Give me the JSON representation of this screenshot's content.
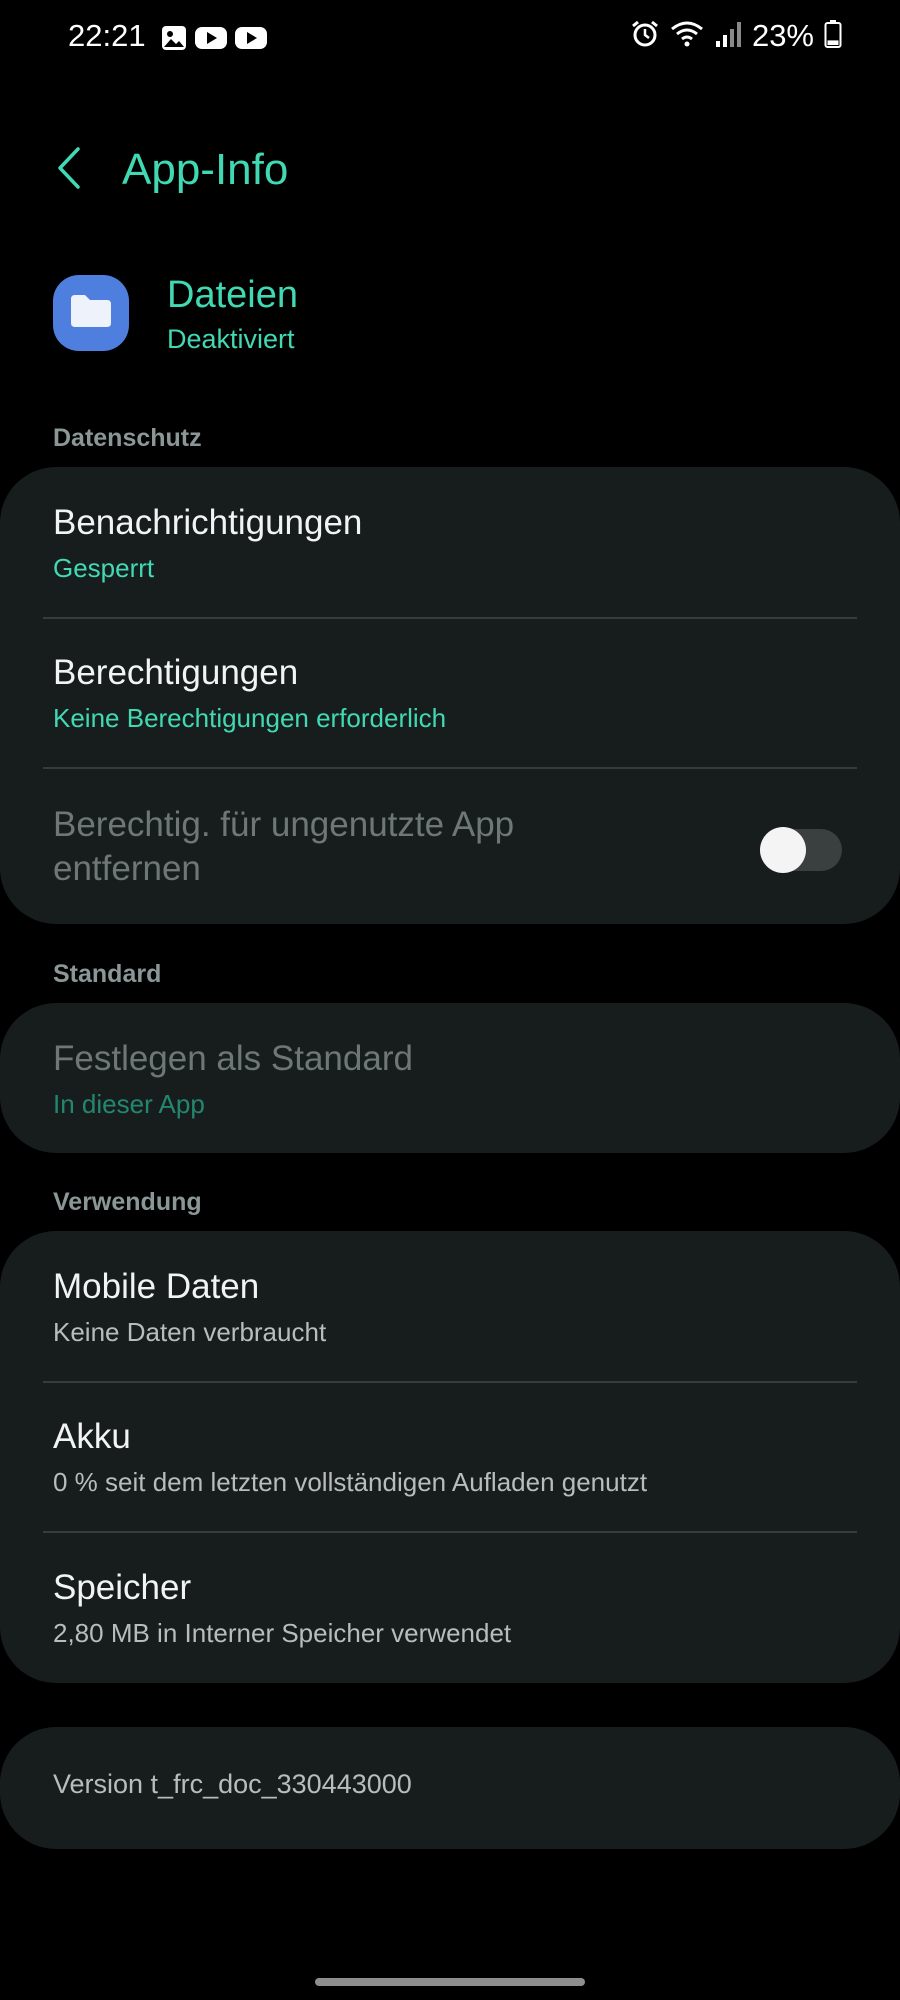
{
  "status_bar": {
    "time": "22:21",
    "battery_percent": "23%",
    "left_icons": [
      "gallery-icon",
      "youtube-icon",
      "youtube-icon"
    ],
    "right_icons": [
      "alarm-icon",
      "wifi-icon",
      "signal-icon",
      "battery-icon"
    ],
    "battery_level": 0.23
  },
  "header": {
    "title": "App-Info"
  },
  "app": {
    "name": "Dateien",
    "status": "Deaktiviert",
    "icon": "folder-icon",
    "icon_color": "#4f7fde"
  },
  "sections": {
    "privacy": {
      "label": "Datenschutz",
      "notifications": {
        "title": "Benachrichtigungen",
        "value": "Gesperrt"
      },
      "permissions": {
        "title": "Berechtigungen",
        "value": "Keine Berechtigungen erforderlich"
      },
      "unused_app": {
        "title_line1": "Berechtig. für ungenutzte App",
        "title_line2": "entfernen",
        "enabled": false
      }
    },
    "default": {
      "label": "Standard",
      "set_default": {
        "title": "Festlegen als Standard",
        "value": "In dieser App"
      }
    },
    "usage": {
      "label": "Verwendung",
      "mobile_data": {
        "title": "Mobile Daten",
        "value": "Keine Daten verbraucht"
      },
      "battery": {
        "title": "Akku",
        "value": "0 % seit dem letzten vollständigen Aufladen genutzt"
      },
      "storage": {
        "title": "Speicher",
        "value": "2,80 MB in Interner Speicher verwendet"
      }
    }
  },
  "version": {
    "text": "Version t_frc_doc_330443000"
  },
  "colors": {
    "accent": "#41d9b3",
    "card_bg": "#171d1d",
    "background": "#000000"
  }
}
